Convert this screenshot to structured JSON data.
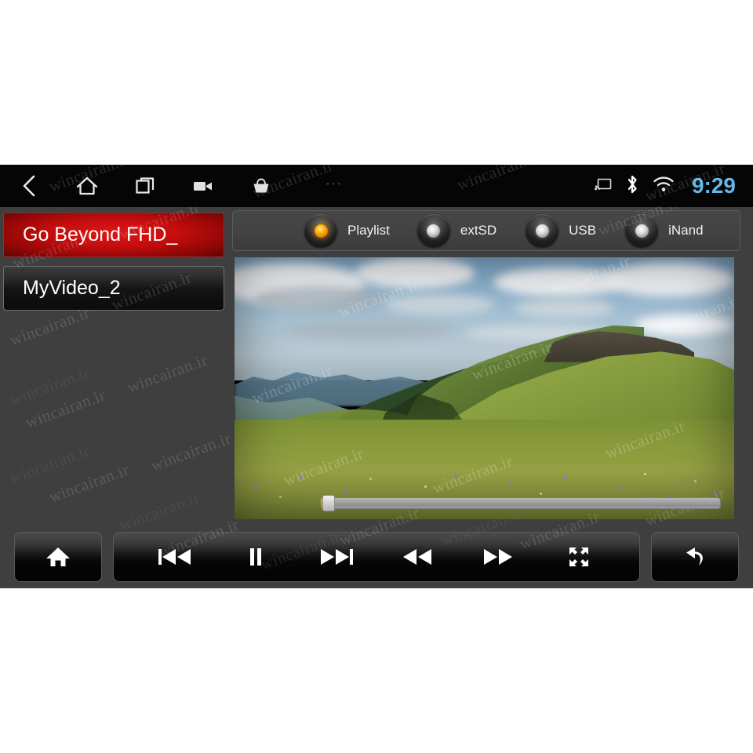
{
  "statusbar": {
    "nav": [
      {
        "name": "back-icon",
        "label": "Back"
      },
      {
        "name": "home-icon",
        "label": "Home"
      },
      {
        "name": "recents-icon",
        "label": "Recent apps"
      },
      {
        "name": "camcorder-icon",
        "label": "Camcorder"
      },
      {
        "name": "basket-icon",
        "label": "Basket"
      }
    ],
    "overflow": "⋯",
    "indicators": [
      {
        "name": "cast-icon",
        "label": "Cast"
      },
      {
        "name": "bluetooth-icon",
        "label": "Bluetooth"
      },
      {
        "name": "wifi-icon",
        "label": "Wi-Fi"
      }
    ],
    "clock": "9:29",
    "clock_color": "#63b8e8"
  },
  "playlist": {
    "items": [
      {
        "title": "Go Beyond FHD_",
        "selected": true
      },
      {
        "title": "MyVideo_2",
        "selected": false
      }
    ],
    "selected_color": "#c40d0d"
  },
  "sources": {
    "options": [
      {
        "label": "Playlist",
        "selected": true
      },
      {
        "label": "extSD",
        "selected": false
      },
      {
        "label": "USB",
        "selected": false
      },
      {
        "label": "iNand",
        "selected": false
      }
    ],
    "selected_indicator_color": "#ffb400"
  },
  "player": {
    "seek": {
      "progress_percent": 2
    }
  },
  "controls": {
    "home": {
      "label": "Home",
      "icon": "home-icon"
    },
    "transport": [
      {
        "label": "Previous",
        "icon": "previous-track-icon"
      },
      {
        "label": "Pause",
        "icon": "pause-icon"
      },
      {
        "label": "Next",
        "icon": "next-track-icon"
      },
      {
        "label": "Rewind",
        "icon": "rewind-icon"
      },
      {
        "label": "Fast forward",
        "icon": "fast-forward-icon"
      },
      {
        "label": "Fullscreen",
        "icon": "fullscreen-icon"
      }
    ],
    "back": {
      "label": "Back",
      "icon": "return-arrow-icon"
    }
  },
  "watermark": {
    "text": "wincairan.ir"
  }
}
